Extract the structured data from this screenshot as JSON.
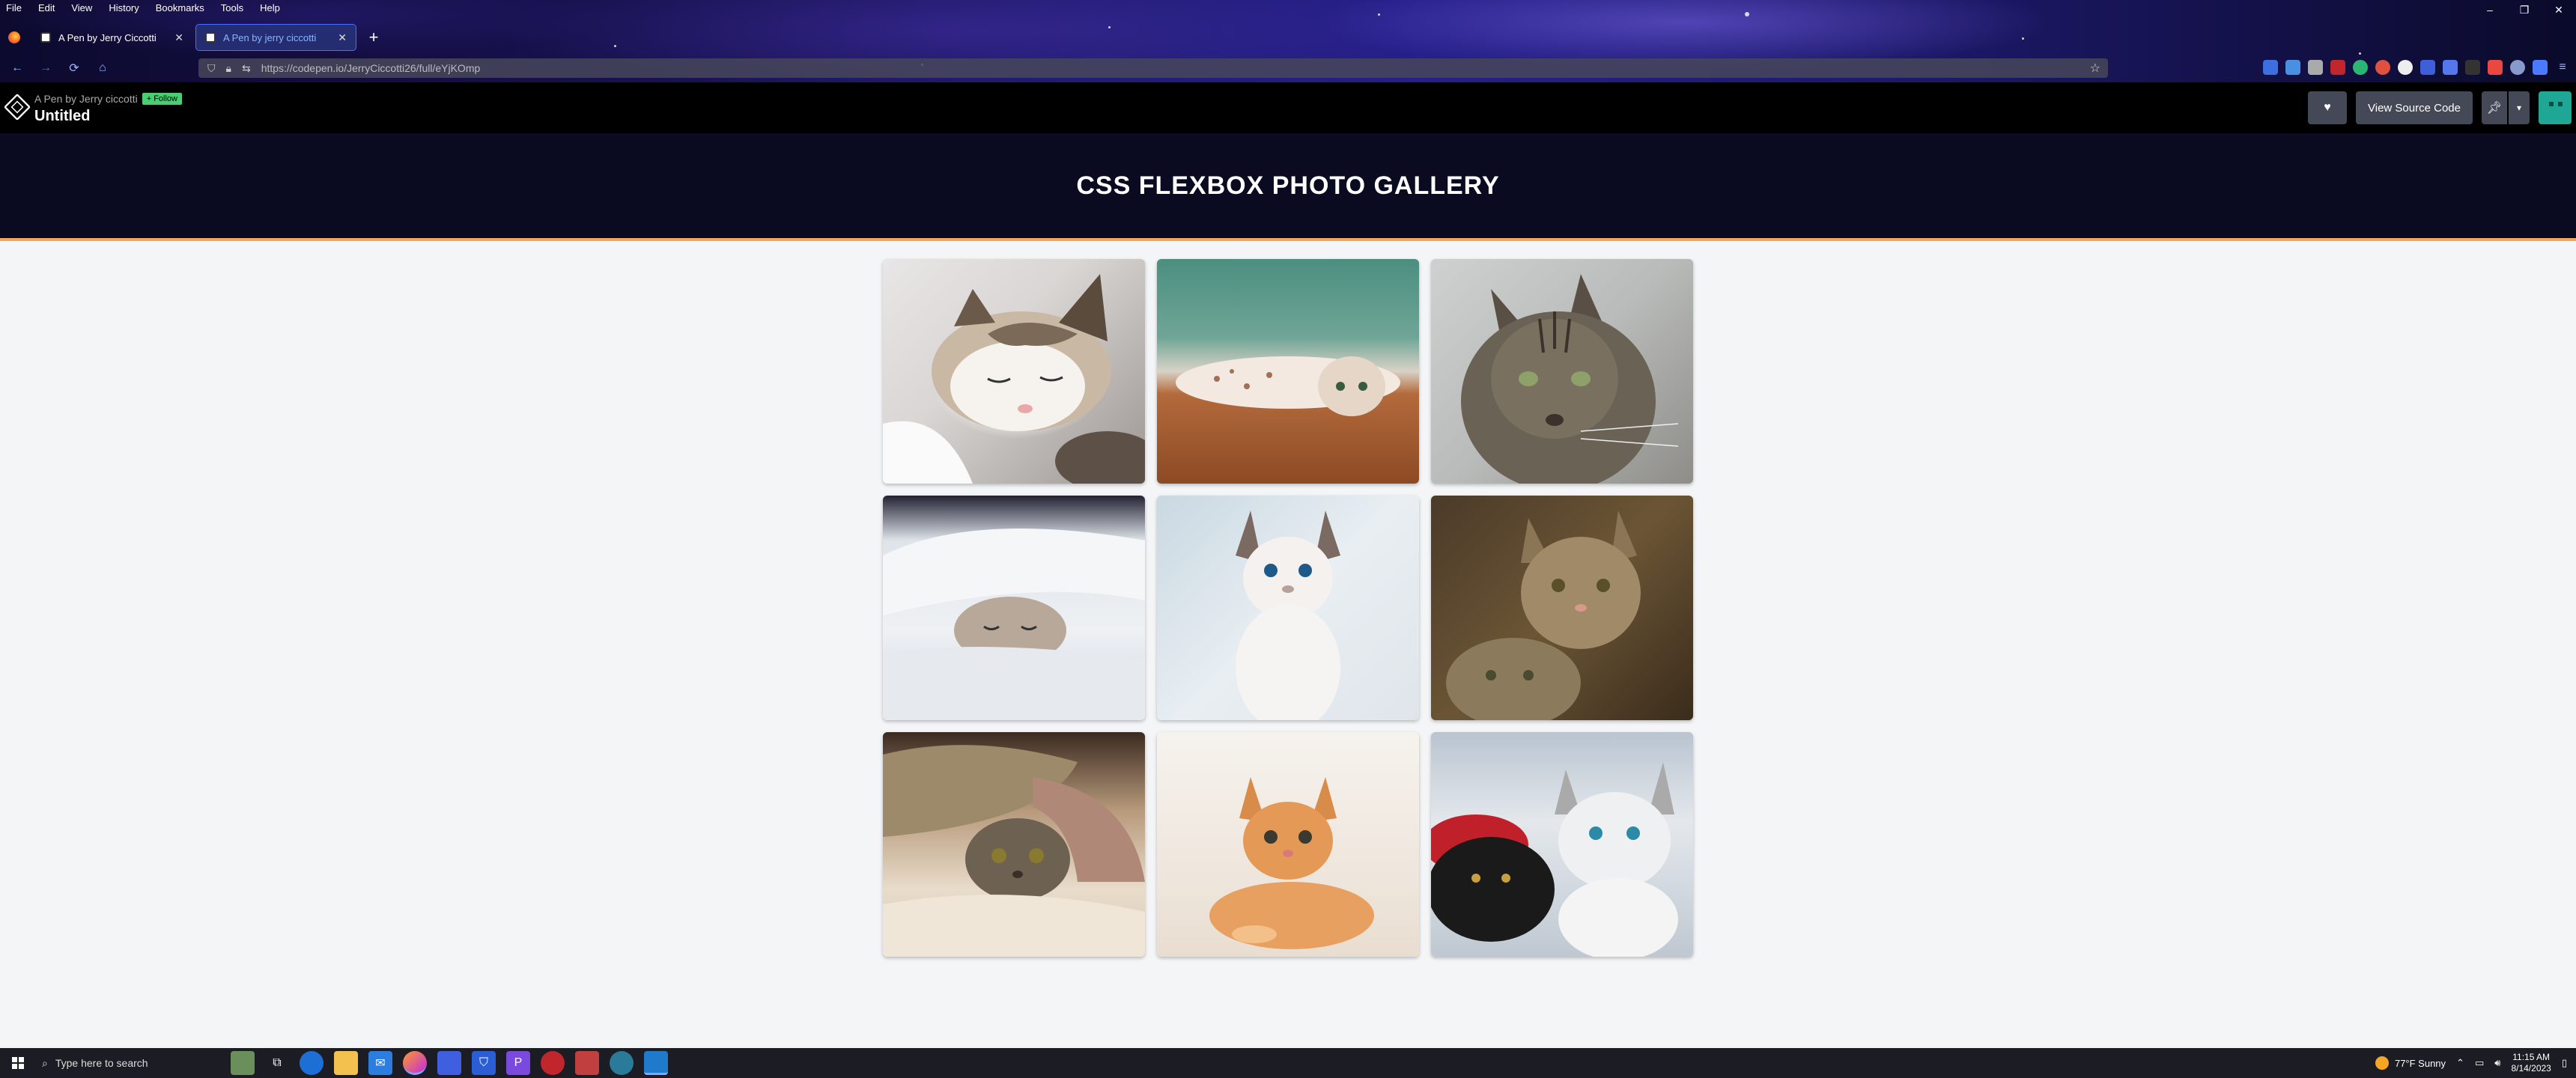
{
  "browser": {
    "menu": [
      "File",
      "Edit",
      "View",
      "History",
      "Bookmarks",
      "Tools",
      "Help"
    ],
    "tabs": [
      {
        "label": "A Pen by Jerry Ciccotti",
        "active": false
      },
      {
        "label": "A Pen by jerry ciccotti",
        "active": true
      }
    ],
    "new_tab": "+",
    "url": "https://codepen.io/JerryCiccotti26/full/eYjKOmp",
    "window_controls": [
      "–",
      "❐",
      "✕"
    ]
  },
  "codepen": {
    "pen_by": "A Pen by Jerry ciccotti",
    "follow": "+ Follow",
    "title": "Untitled",
    "view_source": "View Source Code"
  },
  "gallery": {
    "title": "CSS FLEXBOX PHOTO GALLERY",
    "photos": [
      {
        "icon": "sleeping-white-tabby-kitten"
      },
      {
        "icon": "kitten-on-wood-floor"
      },
      {
        "icon": "gray-tabby-cat"
      },
      {
        "icon": "kitten-under-blanket"
      },
      {
        "icon": "white-blue-eyed-kitten"
      },
      {
        "icon": "two-tabby-kittens"
      },
      {
        "icon": "kitten-under-pillow"
      },
      {
        "icon": "orange-kitten"
      },
      {
        "icon": "black-and-white-kittens"
      }
    ]
  },
  "taskbar": {
    "search_placeholder": "Type here to search",
    "weather": "77°F  Sunny",
    "time": "11:15 AM",
    "date": "8/14/2023"
  }
}
